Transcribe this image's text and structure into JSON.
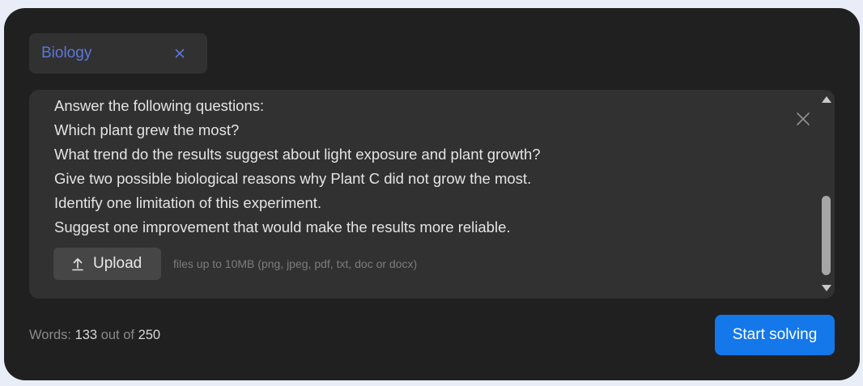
{
  "subject": {
    "label": "Biology",
    "close_icon": "close-icon"
  },
  "prompt": {
    "lines": [
      "Answer the following questions:",
      "Which plant grew the most?",
      "What trend do the results suggest about light exposure and plant growth?",
      "Give two possible biological reasons why Plant C did not grow the most.",
      "Identify one limitation of this experiment.",
      "Suggest one improvement that would make the results more reliable."
    ],
    "clear_icon": "close-icon"
  },
  "upload": {
    "label": "Upload",
    "icon": "upload-icon",
    "hint": "files up to 10MB (png, jpeg, pdf, txt, doc or docx)"
  },
  "word_count": {
    "prefix": "Words:",
    "count": "133",
    "separator": "out of",
    "limit": "250"
  },
  "start_button": {
    "label": "Start solving"
  },
  "colors": {
    "accent": "#1477ea",
    "subject_text": "#5c78d8",
    "panel_bg": "#202020",
    "field_bg": "#313131"
  }
}
